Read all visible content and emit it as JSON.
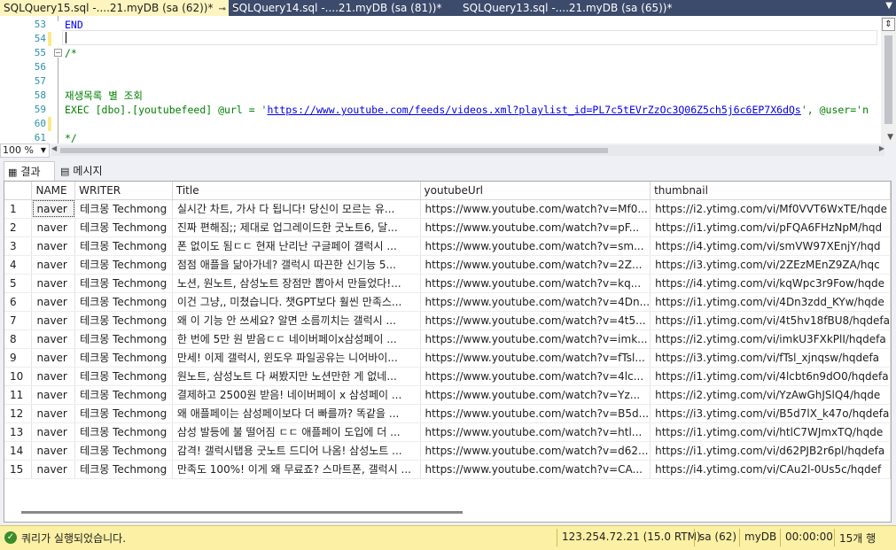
{
  "tabs": [
    {
      "label": "SQLQuery15.sql -....21.myDB (sa (62))*",
      "pin": "⊸",
      "close": "✕"
    },
    {
      "label": "SQLQuery14.sql -....21.myDB (sa (81))*"
    },
    {
      "label": "SQLQuery13.sql -....21.myDB (sa (65))*"
    }
  ],
  "editor": {
    "line_numbers": [
      "53",
      "54",
      "55",
      "56",
      "57",
      "58",
      "59",
      "60",
      "61"
    ],
    "lines": {
      "l53": "END",
      "l55": "/*",
      "l58": "재생목록 별 조회",
      "l59_prefix": "EXEC [dbo].[youtubefeed] @url = '",
      "l59_url": "https://www.youtube.com/feeds/videos.xml?playlist_id=PL7c5tEVrZzOc3Q06Z5ch5j6c6EP7X6dQs",
      "l59_suffix": "', @user='n",
      "l61": "*/"
    }
  },
  "zoom": "100 %",
  "result_tabs": {
    "results": "결과",
    "messages": "메시지"
  },
  "grid": {
    "columns": [
      "NAME",
      "WRITER",
      "Title",
      "youtubeUrl",
      "thumbnail"
    ],
    "rows": [
      [
        "1",
        "naver",
        "테크몽 Techmong",
        "실시간 차트, 가사 다 됩니다! 당신이 모르는 유...",
        "https://www.youtube.com/watch?v=Mf0...",
        "https://i2.ytimg.com/vi/Mf0VVT6WxTE/hqde"
      ],
      [
        "2",
        "naver",
        "테크몽 Techmong",
        "진짜 편해짐;; 제대로 업그레이드한 굿노트6, 달...",
        "https://www.youtube.com/watch?v=pF...",
        "https://i1.ytimg.com/vi/pFQA6FHzNpM/hqd"
      ],
      [
        "3",
        "naver",
        "테크몽 Techmong",
        "폰 없이도 됨ㄷㄷ 현재 난리난 구글페이 갤럭시 ...",
        "https://www.youtube.com/watch?v=sm...",
        "https://i4.ytimg.com/vi/smVW97XEnjY/hqd"
      ],
      [
        "4",
        "naver",
        "테크몽 Techmong",
        "점점 애플을 닮아가네? 갤럭시 따끈한 신기능 5...",
        "https://www.youtube.com/watch?v=2Z...",
        "https://i3.ytimg.com/vi/2ZEzMEnZ9ZA/hqc"
      ],
      [
        "5",
        "naver",
        "테크몽 Techmong",
        "노션, 원노트, 삼성노트 장점만 뽑아서 만들었다!...",
        "https://www.youtube.com/watch?v=kq...",
        "https://i4.ytimg.com/vi/kqWpc3r9Fow/hqde"
      ],
      [
        "6",
        "naver",
        "테크몽 Techmong",
        "이건 그냥,, 미쳤습니다. 챗GPT보다 훨씬 만족스...",
        "https://www.youtube.com/watch?v=4Dn...",
        "https://i1.ytimg.com/vi/4Dn3zdd_KYw/hqde"
      ],
      [
        "7",
        "naver",
        "테크몽 Techmong",
        "왜 이 기능 안 쓰세요? 알면 소름끼치는 갤럭시 ...",
        "https://www.youtube.com/watch?v=4t5...",
        "https://i1.ytimg.com/vi/4t5hv18fBU8/hqdefa"
      ],
      [
        "8",
        "naver",
        "테크몽 Techmong",
        "한 번에 5만 원 받음ㄷㄷ 네이버페이x삼성페이 ...",
        "https://www.youtube.com/watch?v=imk...",
        "https://i2.ytimg.com/vi/imkU3FXkPlI/hqdefa"
      ],
      [
        "9",
        "naver",
        "테크몽 Techmong",
        "만세! 이제 갤럭시, 윈도우 파일공유는 니어바이...",
        "https://www.youtube.com/watch?v=fTsl...",
        "https://i3.ytimg.com/vi/fTsl_xjnqsw/hqdefa"
      ],
      [
        "10",
        "naver",
        "테크몽 Techmong",
        "원노트, 삼성노트 다 써봤지만 노션만한 게 없네...",
        "https://www.youtube.com/watch?v=4lc...",
        "https://i1.ytimg.com/vi/4lcbt6n9dO0/hqdefa"
      ],
      [
        "11",
        "naver",
        "테크몽 Techmong",
        "결제하고 2500원 받음! 네이버페이 x 삼성페이 ...",
        "https://www.youtube.com/watch?v=Yz...",
        "https://i2.ytimg.com/vi/YzAwGhJSlQ4/hqde"
      ],
      [
        "12",
        "naver",
        "테크몽 Techmong",
        "왜 애플페이는 삼성페이보다 더 빠를까? 똑같을 ...",
        "https://www.youtube.com/watch?v=B5d...",
        "https://i3.ytimg.com/vi/B5d7lX_k47o/hqdefa"
      ],
      [
        "13",
        "naver",
        "테크몽 Techmong",
        "삼성 발등에 불 떨어짐 ㄷㄷ 애플페이 도입에 더 ...",
        "https://www.youtube.com/watch?v=htl...",
        "https://i1.ytimg.com/vi/htlC7WJmxTQ/hqde"
      ],
      [
        "14",
        "naver",
        "테크몽 Techmong",
        "감격! 갤럭시탭용 굿노트 드디어 나옴! 삼성노트 ...",
        "https://www.youtube.com/watch?v=d62...",
        "https://i1.ytimg.com/vi/d62PJB2r6pl/hqdefa"
      ],
      [
        "15",
        "naver",
        "테크몽 Techmong",
        "만족도 100%! 이게 왜 무료죠? 스마트폰, 갤럭시 ...",
        "https://www.youtube.com/watch?v=CA...",
        "https://i4.ytimg.com/vi/CAu2l-0Us5c/hqdef"
      ]
    ]
  },
  "status": {
    "message": "쿼리가 실행되었습니다.",
    "server": "123.254.72.21 (15.0 RTM)",
    "user": "sa (62)",
    "database": "myDB",
    "elapsed": "00:00:00",
    "rows": "15개 행"
  }
}
